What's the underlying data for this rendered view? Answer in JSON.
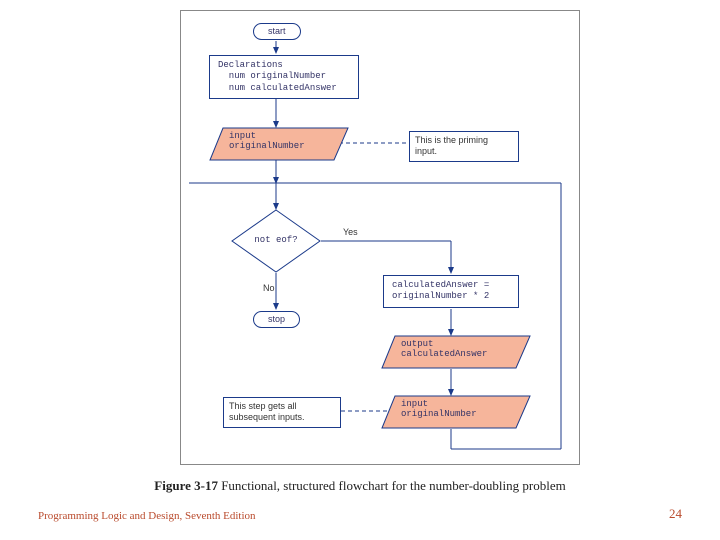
{
  "chart_data": {
    "type": "flowchart",
    "title": "Functional, structured flowchart for the number-doubling problem",
    "nodes": [
      {
        "id": "start",
        "shape": "terminal",
        "text": "start"
      },
      {
        "id": "decl",
        "shape": "process",
        "text": "Declarations\n  num originalNumber\n  num calculatedAnswer"
      },
      {
        "id": "in1",
        "shape": "io",
        "text": "input\noriginalNumber"
      },
      {
        "id": "note1",
        "shape": "annotation",
        "text": "This is the priming input."
      },
      {
        "id": "dec",
        "shape": "decision",
        "text": "not eof?"
      },
      {
        "id": "calc",
        "shape": "process",
        "text": "calculatedAnswer =\noriginalNumber * 2"
      },
      {
        "id": "out",
        "shape": "io",
        "text": "output\ncalculatedAnswer"
      },
      {
        "id": "in2",
        "shape": "io",
        "text": "input\noriginalNumber"
      },
      {
        "id": "note2",
        "shape": "annotation",
        "text": "This step gets all subsequent inputs."
      },
      {
        "id": "stop",
        "shape": "terminal",
        "text": "stop"
      }
    ],
    "edges": [
      {
        "from": "start",
        "to": "decl"
      },
      {
        "from": "decl",
        "to": "in1"
      },
      {
        "from": "in1",
        "to": "note1",
        "style": "dashed"
      },
      {
        "from": "in1",
        "to": "dec"
      },
      {
        "from": "dec",
        "to": "calc",
        "label": "Yes"
      },
      {
        "from": "dec",
        "to": "stop",
        "label": "No"
      },
      {
        "from": "calc",
        "to": "out"
      },
      {
        "from": "out",
        "to": "in2"
      },
      {
        "from": "in2",
        "to": "dec",
        "style": "loop-back"
      },
      {
        "from": "note2",
        "to": "in2",
        "style": "dashed"
      }
    ]
  },
  "nodes": {
    "start": "start",
    "decl_l1": "Declarations",
    "decl_l2": "  num originalNumber",
    "decl_l3": "  num calculatedAnswer",
    "in1_l1": "input",
    "in1_l2": "originalNumber",
    "note1_l1": "This is the priming",
    "note1_l2": "input.",
    "dec": "not eof?",
    "yes": "Yes",
    "no": "No",
    "calc_l1": "calculatedAnswer =",
    "calc_l2": "originalNumber * 2",
    "out_l1": "output",
    "out_l2": "calculatedAnswer",
    "in2_l1": "input",
    "in2_l2": "originalNumber",
    "note2_l1": "This step gets all",
    "note2_l2": "subsequent inputs.",
    "stop": "stop"
  },
  "caption_bold": "Figure 3-17",
  "caption_rest": " Functional, structured flowchart for the number-doubling problem",
  "footer_left": "Programming Logic and Design, Seventh Edition",
  "footer_right": "24"
}
